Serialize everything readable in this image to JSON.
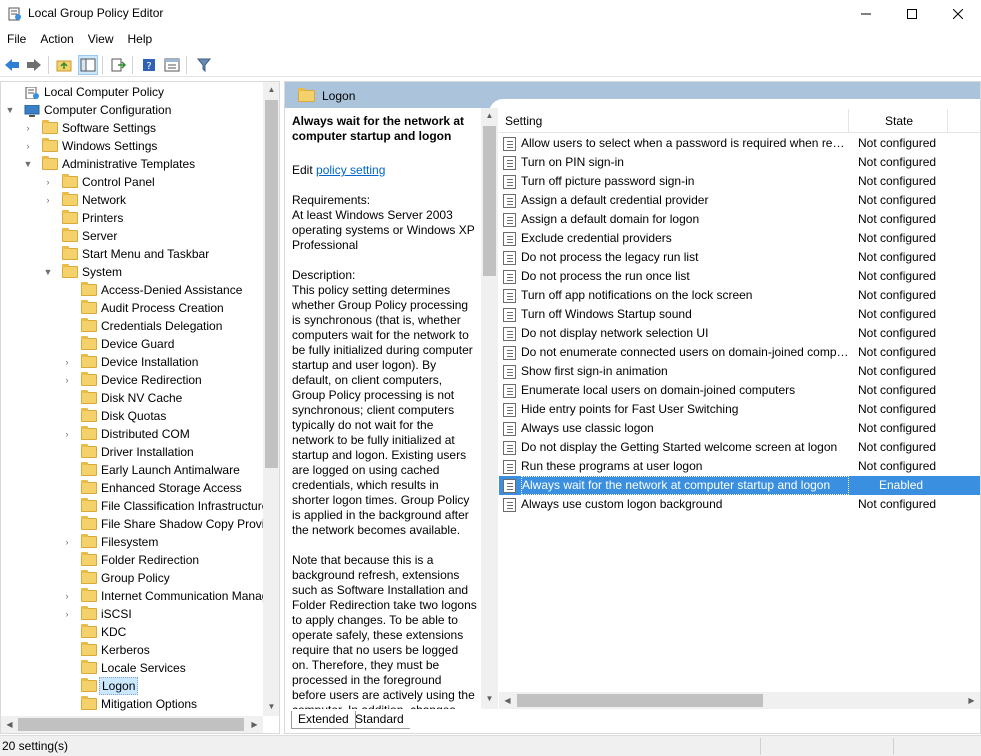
{
  "window": {
    "title": "Local Group Policy Editor",
    "minimize": "—",
    "maximize": "☐",
    "close": "✕"
  },
  "menu": [
    "File",
    "Action",
    "View",
    "Help"
  ],
  "tree": {
    "rows": [
      {
        "label": "Local Computer Policy",
        "level": 0,
        "expander": "",
        "icon": "policy-icon"
      },
      {
        "label": "Computer Configuration",
        "level": 0,
        "expander": "▼",
        "icon": "computer-icon"
      },
      {
        "label": "Software Settings",
        "level": 1,
        "expander": "›",
        "icon": "folder-icon"
      },
      {
        "label": "Windows Settings",
        "level": 1,
        "expander": "›",
        "icon": "folder-icon"
      },
      {
        "label": "Administrative Templates",
        "level": 1,
        "expander": "▼",
        "icon": "folder-icon"
      },
      {
        "label": "Control Panel",
        "level": 2,
        "expander": "›",
        "icon": "folder-icon"
      },
      {
        "label": "Network",
        "level": 2,
        "expander": "›",
        "icon": "folder-icon"
      },
      {
        "label": "Printers",
        "level": 2,
        "expander": "",
        "icon": "folder-icon"
      },
      {
        "label": "Server",
        "level": 2,
        "expander": "",
        "icon": "folder-icon"
      },
      {
        "label": "Start Menu and Taskbar",
        "level": 2,
        "expander": "",
        "icon": "folder-icon"
      },
      {
        "label": "System",
        "level": 2,
        "expander": "▼",
        "icon": "folder-icon"
      },
      {
        "label": "Access-Denied Assistance",
        "level": 3,
        "expander": "",
        "icon": "folder-icon"
      },
      {
        "label": "Audit Process Creation",
        "level": 3,
        "expander": "",
        "icon": "folder-icon"
      },
      {
        "label": "Credentials Delegation",
        "level": 3,
        "expander": "",
        "icon": "folder-icon"
      },
      {
        "label": "Device Guard",
        "level": 3,
        "expander": "",
        "icon": "folder-icon"
      },
      {
        "label": "Device Installation",
        "level": 3,
        "expander": "›",
        "icon": "folder-icon"
      },
      {
        "label": "Device Redirection",
        "level": 3,
        "expander": "›",
        "icon": "folder-icon"
      },
      {
        "label": "Disk NV Cache",
        "level": 3,
        "expander": "",
        "icon": "folder-icon"
      },
      {
        "label": "Disk Quotas",
        "level": 3,
        "expander": "",
        "icon": "folder-icon"
      },
      {
        "label": "Distributed COM",
        "level": 3,
        "expander": "›",
        "icon": "folder-icon"
      },
      {
        "label": "Driver Installation",
        "level": 3,
        "expander": "",
        "icon": "folder-icon"
      },
      {
        "label": "Early Launch Antimalware",
        "level": 3,
        "expander": "",
        "icon": "folder-icon"
      },
      {
        "label": "Enhanced Storage Access",
        "level": 3,
        "expander": "",
        "icon": "folder-icon"
      },
      {
        "label": "File Classification Infrastructure",
        "level": 3,
        "expander": "",
        "icon": "folder-icon"
      },
      {
        "label": "File Share Shadow Copy Provider",
        "level": 3,
        "expander": "",
        "icon": "folder-icon"
      },
      {
        "label": "Filesystem",
        "level": 3,
        "expander": "›",
        "icon": "folder-icon"
      },
      {
        "label": "Folder Redirection",
        "level": 3,
        "expander": "",
        "icon": "folder-icon"
      },
      {
        "label": "Group Policy",
        "level": 3,
        "expander": "",
        "icon": "folder-icon"
      },
      {
        "label": "Internet Communication Management",
        "level": 3,
        "expander": "›",
        "icon": "folder-icon"
      },
      {
        "label": "iSCSI",
        "level": 3,
        "expander": "›",
        "icon": "folder-icon"
      },
      {
        "label": "KDC",
        "level": 3,
        "expander": "",
        "icon": "folder-icon"
      },
      {
        "label": "Kerberos",
        "level": 3,
        "expander": "",
        "icon": "folder-icon"
      },
      {
        "label": "Locale Services",
        "level": 3,
        "expander": "",
        "icon": "folder-icon"
      },
      {
        "label": "Logon",
        "level": 3,
        "expander": "",
        "icon": "folder-icon",
        "selected": true
      },
      {
        "label": "Mitigation Options",
        "level": 3,
        "expander": "",
        "icon": "folder-icon"
      }
    ]
  },
  "right": {
    "header_title": "Logon",
    "description": {
      "title": "Always wait for the network at computer startup and logon",
      "edit_prefix": "Edit ",
      "edit_link": "policy setting ",
      "body": "Requirements:\nAt least Windows Server 2003 operating systems or Windows XP Professional\n\nDescription:\nThis policy setting determines whether Group Policy processing is synchronous (that is, whether computers wait for the network to be fully initialized during computer startup and user logon). By default, on client computers, Group Policy processing is not synchronous; client computers typically do not wait for the network to be fully initialized at startup and logon. Existing users are logged on using cached credentials, which results in shorter logon times. Group Policy is applied in the background after the network becomes available.\n\nNote that because this is a background refresh, extensions such as Software Installation and Folder Redirection take two logons to apply changes. To be able to operate safely, these extensions require that no users be logged on. Therefore, they must be processed in the foreground before users are actively using the computer. In addition, changes"
    },
    "columns": {
      "setting": "Setting",
      "state": "State"
    },
    "settings": [
      {
        "name": "Allow users to select when a password is required when resuming from connected standby",
        "state": "Not configured"
      },
      {
        "name": "Turn on PIN sign-in",
        "state": "Not configured"
      },
      {
        "name": "Turn off picture password sign-in",
        "state": "Not configured"
      },
      {
        "name": "Assign a default credential provider",
        "state": "Not configured"
      },
      {
        "name": "Assign a default domain for logon",
        "state": "Not configured"
      },
      {
        "name": "Exclude credential providers",
        "state": "Not configured"
      },
      {
        "name": "Do not process the legacy run list",
        "state": "Not configured"
      },
      {
        "name": "Do not process the run once list",
        "state": "Not configured"
      },
      {
        "name": "Turn off app notifications on the lock screen",
        "state": "Not configured"
      },
      {
        "name": "Turn off Windows Startup sound",
        "state": "Not configured"
      },
      {
        "name": "Do not display network selection UI",
        "state": "Not configured"
      },
      {
        "name": "Do not enumerate connected users on domain-joined computers",
        "state": "Not configured"
      },
      {
        "name": "Show first sign-in animation",
        "state": "Not configured"
      },
      {
        "name": "Enumerate local users on domain-joined computers",
        "state": "Not configured"
      },
      {
        "name": "Hide entry points for Fast User Switching",
        "state": "Not configured"
      },
      {
        "name": "Always use classic logon",
        "state": "Not configured"
      },
      {
        "name": "Do not display the Getting Started welcome screen at logon",
        "state": "Not configured"
      },
      {
        "name": "Run these programs at user logon",
        "state": "Not configured"
      },
      {
        "name": "Always wait for the network at computer startup and logon",
        "state": "Enabled",
        "selected": true
      },
      {
        "name": "Always use custom logon background",
        "state": "Not configured"
      }
    ],
    "tabs": [
      "Extended",
      "Standard"
    ]
  },
  "status": {
    "text": "20 setting(s)"
  },
  "colors": {
    "selection": "#3a8fe0",
    "header": "#abc3db",
    "tree_selection": "#cce8ff"
  }
}
